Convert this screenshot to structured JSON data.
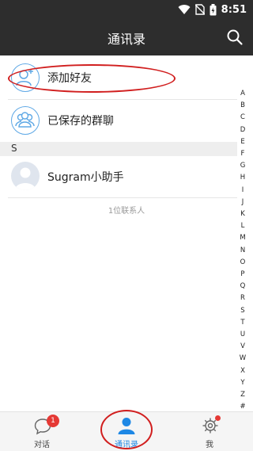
{
  "status_bar": {
    "time": "8:51",
    "icons": [
      "wifi-icon",
      "no-sim-icon",
      "battery-charging-icon"
    ]
  },
  "header": {
    "title": "通讯录",
    "search_icon": "search-icon"
  },
  "list": {
    "add_friend_label": "添加好友",
    "saved_groups_label": "已保存的群聊",
    "section_letter": "S",
    "contact_name": "Sugram小助手",
    "contact_count": "1位联系人"
  },
  "alphabet": [
    "A",
    "B",
    "C",
    "D",
    "E",
    "F",
    "G",
    "H",
    "I",
    "J",
    "K",
    "L",
    "M",
    "N",
    "O",
    "P",
    "Q",
    "R",
    "S",
    "T",
    "U",
    "V",
    "W",
    "X",
    "Y",
    "Z",
    "#"
  ],
  "bottom_nav": {
    "chat_label": "对话",
    "chat_badge": "1",
    "contacts_label": "通讯录",
    "me_label": "我"
  },
  "colors": {
    "header_bg": "#2d2d2d",
    "accent_blue": "#1e88e5",
    "avatar_outline": "#5ea8e5",
    "badge_red": "#e53935",
    "annotation_red": "#d11f1f"
  }
}
